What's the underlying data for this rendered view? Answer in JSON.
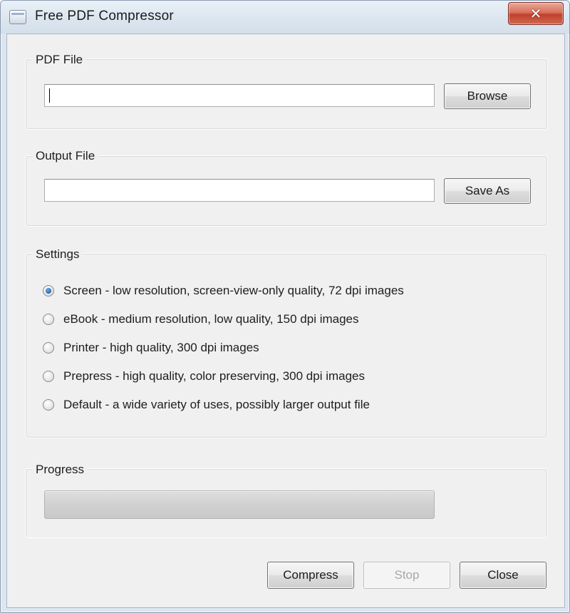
{
  "window": {
    "title": "Free PDF Compressor",
    "close_glyph": "✕"
  },
  "pdf_file": {
    "group_label": "PDF File",
    "value": "",
    "browse_label": "Browse"
  },
  "output_file": {
    "group_label": "Output File",
    "value": "",
    "save_as_label": "Save As"
  },
  "settings": {
    "group_label": "Settings",
    "options": [
      {
        "label": "Screen - low resolution, screen-view-only quality, 72 dpi images",
        "checked": true
      },
      {
        "label": "eBook - medium resolution, low quality, 150 dpi images",
        "checked": false
      },
      {
        "label": "Printer - high quality, 300 dpi images",
        "checked": false
      },
      {
        "label": "Prepress - high quality, color preserving, 300 dpi images",
        "checked": false
      },
      {
        "label": "Default - a wide variety of uses, possibly larger output file",
        "checked": false
      }
    ]
  },
  "progress": {
    "group_label": "Progress",
    "value_percent": 0
  },
  "buttons": {
    "compress_label": "Compress",
    "stop_label": "Stop",
    "stop_enabled": false,
    "close_label": "Close"
  },
  "colors": {
    "close_button": "#c0412c",
    "radio_selected": "#2a6fb2",
    "dialog_background": "#f0f0f0"
  }
}
